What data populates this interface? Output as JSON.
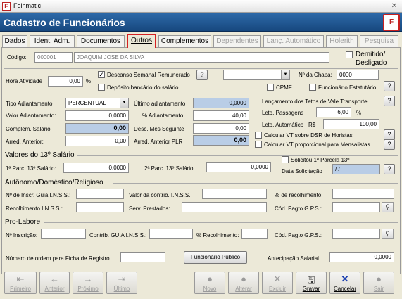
{
  "window": {
    "title": "Folhmatic",
    "header": "Cadastro de Funcionários"
  },
  "tabs": [
    "Dados",
    "Ident. Adm.",
    "Documentos",
    "Outros",
    "Complementos",
    "Dependentes",
    "Lanç. Automático",
    "Holerith",
    "Pesquisa"
  ],
  "codigo": {
    "label": "Código:",
    "value": "000001",
    "name": "JOAQUIM JOSE DA SILVA"
  },
  "demitido": "Demitido/ Desligado",
  "hora": {
    "label": "Hora Atividade",
    "value": "0,00",
    "unit": "%"
  },
  "dsr": {
    "label": "Descanso Semanal Remunerado",
    "checked": "✓"
  },
  "deposito": "Depósito bancário do salário",
  "chapa": {
    "label": "Nº da Chapa:",
    "value": "0000"
  },
  "cpmf": "CPMF",
  "estatutario": "Funcionário Estatutário",
  "q": "?",
  "tipo": {
    "label": "Tipo Adiantamento",
    "value": "PERCENTUAL"
  },
  "valor_adiant": {
    "label": "Valor Adiantamento:",
    "value": "0,0000"
  },
  "complem": {
    "label": "Complem. Salário",
    "value": "0,00"
  },
  "arred_ant": {
    "label": "Arred. Anterior:",
    "value": "0,00"
  },
  "ultimo": {
    "label": "Último adiantamento",
    "value": "0,0000"
  },
  "pct_adiant": {
    "label": "% Adiantamento:",
    "value": "40,00"
  },
  "desc_mes": {
    "label": "Desc. Mês Seguinte",
    "value": "0,00"
  },
  "arred_plr": {
    "label": "Arred. Anterior PLR",
    "value": "0,00"
  },
  "vt": {
    "title": "Lançamento dos Tetos de Vale Transporte",
    "passagens_label": "Lcto. Passagens",
    "passagens": "6,00",
    "pct": "%",
    "auto_label": "Lcto. Automático",
    "rs": "R$",
    "auto": "100,00",
    "dsr": "Calcular VT sobre DSR de Horistas",
    "prop": "Calcular VT proporcional para Mensalistas"
  },
  "decimo": {
    "title": "Valores do 13º Salário",
    "p1_label": "1ª Parc. 13º Salário:",
    "p1": "0,0000",
    "p2_label": "2ª Parc. 13º Salário:",
    "p2": "0,0000",
    "solicitou": "Solicitou 1ª Parcela 13º",
    "data_label": "Data Solicitação",
    "data": "/ /"
  },
  "autonomo": {
    "title": "Autônomo/Doméstico/Religioso",
    "inscr": "Nº de Inscr. Guia I.N.S.S.:",
    "valor": "Valor da contrib. I.N.S.S.:",
    "pct": "% de recolhimento:",
    "recolh": "Recolhimento I.N.S.S.:",
    "serv": "Serv. Prestados:",
    "cod": "Cód. Pagto G.P.S.:"
  },
  "prolabore": {
    "title": "Pro-Labore",
    "inscr": "Nº Inscrição:",
    "contrib": "Contrib. GUIA I.N.S.S.:",
    "pct": "% Recolhimento:",
    "cod": "Cód. Pagto G.P.S.:"
  },
  "ordem": "Número de ordem para Ficha de Registro",
  "func_publico": "Funcionário Público",
  "antecipacao": {
    "label": "Antecipação Salarial",
    "value": "0,0000"
  },
  "buttons": [
    "Primeiro",
    "Anterior",
    "Próximo",
    "Último",
    "Novo",
    "Alterar",
    "Excluir",
    "Gravar",
    "Cancelar",
    "Sair"
  ],
  "icons": {
    "first": "⇤",
    "prev": "←",
    "next": "→",
    "last": "⇥",
    "new": "●",
    "edit": "●",
    "del": "✕",
    "save": "🖫",
    "cancel": "✕",
    "exit": "●",
    "search": "🔍"
  }
}
